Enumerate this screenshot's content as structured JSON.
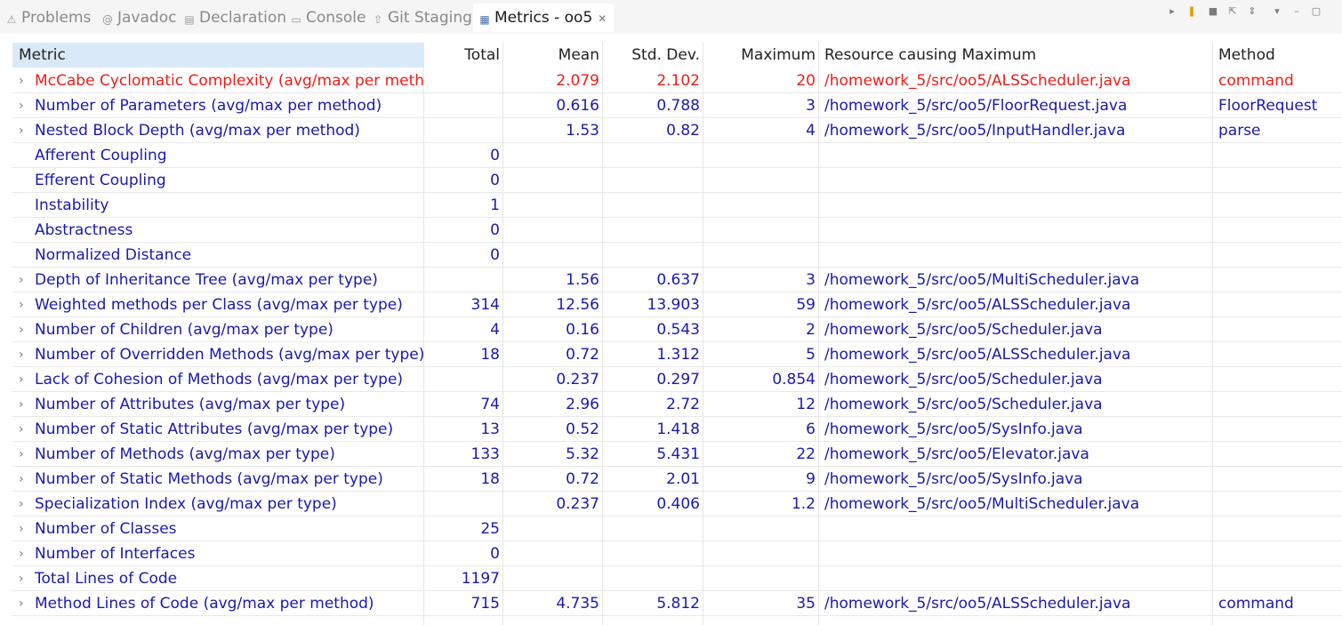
{
  "tabs": [
    {
      "label": "Problems",
      "icon": "problems-icon",
      "glyph": "⚠"
    },
    {
      "label": "Javadoc",
      "icon": "javadoc-icon",
      "glyph": "@"
    },
    {
      "label": "Declaration",
      "icon": "declaration-icon",
      "glyph": "▤"
    },
    {
      "label": "Console",
      "icon": "console-icon",
      "glyph": "▭"
    },
    {
      "label": "Git Staging",
      "icon": "git-staging-icon",
      "glyph": "⇧"
    },
    {
      "label": "Metrics - oo5",
      "icon": "metrics-icon",
      "glyph": "▦",
      "active": true
    }
  ],
  "view_tools": [
    "run-icon",
    "pause-icon",
    "stop-icon",
    "export-icon",
    "layout-icon",
    "view-menu-icon",
    "minimize-icon",
    "maximize-icon"
  ],
  "columns": [
    "Metric",
    "Total",
    "Mean",
    "Std. Dev.",
    "Maximum",
    "Resource causing Maximum",
    "Method"
  ],
  "rows": [
    {
      "metric": "McCabe Cyclomatic Complexity (avg/max per method)",
      "total": "",
      "mean": "2.079",
      "std": "2.102",
      "max": "20",
      "resource": "/homework_5/src/oo5/ALSScheduler.java",
      "method": "command",
      "expandable": true,
      "warning": true
    },
    {
      "metric": "Number of Parameters (avg/max per method)",
      "total": "",
      "mean": "0.616",
      "std": "0.788",
      "max": "3",
      "resource": "/homework_5/src/oo5/FloorRequest.java",
      "method": "FloorRequest",
      "expandable": true
    },
    {
      "metric": "Nested Block Depth (avg/max per method)",
      "total": "",
      "mean": "1.53",
      "std": "0.82",
      "max": "4",
      "resource": "/homework_5/src/oo5/InputHandler.java",
      "method": "parse",
      "expandable": true
    },
    {
      "metric": "Afferent Coupling",
      "total": "0",
      "mean": "",
      "std": "",
      "max": "",
      "resource": "",
      "method": "",
      "expandable": false
    },
    {
      "metric": "Efferent Coupling",
      "total": "0",
      "mean": "",
      "std": "",
      "max": "",
      "resource": "",
      "method": "",
      "expandable": false
    },
    {
      "metric": "Instability",
      "total": "1",
      "mean": "",
      "std": "",
      "max": "",
      "resource": "",
      "method": "",
      "expandable": false
    },
    {
      "metric": "Abstractness",
      "total": "0",
      "mean": "",
      "std": "",
      "max": "",
      "resource": "",
      "method": "",
      "expandable": false
    },
    {
      "metric": "Normalized Distance",
      "total": "0",
      "mean": "",
      "std": "",
      "max": "",
      "resource": "",
      "method": "",
      "expandable": false
    },
    {
      "metric": "Depth of Inheritance Tree (avg/max per type)",
      "total": "",
      "mean": "1.56",
      "std": "0.637",
      "max": "3",
      "resource": "/homework_5/src/oo5/MultiScheduler.java",
      "method": "",
      "expandable": true
    },
    {
      "metric": "Weighted methods per Class (avg/max per type)",
      "total": "314",
      "mean": "12.56",
      "std": "13.903",
      "max": "59",
      "resource": "/homework_5/src/oo5/ALSScheduler.java",
      "method": "",
      "expandable": true
    },
    {
      "metric": "Number of Children (avg/max per type)",
      "total": "4",
      "mean": "0.16",
      "std": "0.543",
      "max": "2",
      "resource": "/homework_5/src/oo5/Scheduler.java",
      "method": "",
      "expandable": true
    },
    {
      "metric": "Number of Overridden Methods (avg/max per type)",
      "total": "18",
      "mean": "0.72",
      "std": "1.312",
      "max": "5",
      "resource": "/homework_5/src/oo5/ALSScheduler.java",
      "method": "",
      "expandable": true
    },
    {
      "metric": "Lack of Cohesion of Methods (avg/max per type)",
      "total": "",
      "mean": "0.237",
      "std": "0.297",
      "max": "0.854",
      "resource": "/homework_5/src/oo5/Scheduler.java",
      "method": "",
      "expandable": true
    },
    {
      "metric": "Number of Attributes (avg/max per type)",
      "total": "74",
      "mean": "2.96",
      "std": "2.72",
      "max": "12",
      "resource": "/homework_5/src/oo5/Scheduler.java",
      "method": "",
      "expandable": true
    },
    {
      "metric": "Number of Static Attributes (avg/max per type)",
      "total": "13",
      "mean": "0.52",
      "std": "1.418",
      "max": "6",
      "resource": "/homework_5/src/oo5/SysInfo.java",
      "method": "",
      "expandable": true
    },
    {
      "metric": "Number of Methods (avg/max per type)",
      "total": "133",
      "mean": "5.32",
      "std": "5.431",
      "max": "22",
      "resource": "/homework_5/src/oo5/Elevator.java",
      "method": "",
      "expandable": true
    },
    {
      "metric": "Number of Static Methods (avg/max per type)",
      "total": "18",
      "mean": "0.72",
      "std": "2.01",
      "max": "9",
      "resource": "/homework_5/src/oo5/SysInfo.java",
      "method": "",
      "expandable": true
    },
    {
      "metric": "Specialization Index (avg/max per type)",
      "total": "",
      "mean": "0.237",
      "std": "0.406",
      "max": "1.2",
      "resource": "/homework_5/src/oo5/MultiScheduler.java",
      "method": "",
      "expandable": true
    },
    {
      "metric": "Number of Classes",
      "total": "25",
      "mean": "",
      "std": "",
      "max": "",
      "resource": "",
      "method": "",
      "expandable": true
    },
    {
      "metric": "Number of Interfaces",
      "total": "0",
      "mean": "",
      "std": "",
      "max": "",
      "resource": "",
      "method": "",
      "expandable": true
    },
    {
      "metric": "Total Lines of Code",
      "total": "1197",
      "mean": "",
      "std": "",
      "max": "",
      "resource": "",
      "method": "",
      "expandable": true
    },
    {
      "metric": "Method Lines of Code (avg/max per method)",
      "total": "715",
      "mean": "4.735",
      "std": "5.812",
      "max": "35",
      "resource": "/homework_5/src/oo5/ALSScheduler.java",
      "method": "command",
      "expandable": true
    }
  ],
  "colors": {
    "metric_text": "#1a1aa8",
    "warning_text": "#e8201a",
    "header_selected": "#d9e9f7"
  }
}
